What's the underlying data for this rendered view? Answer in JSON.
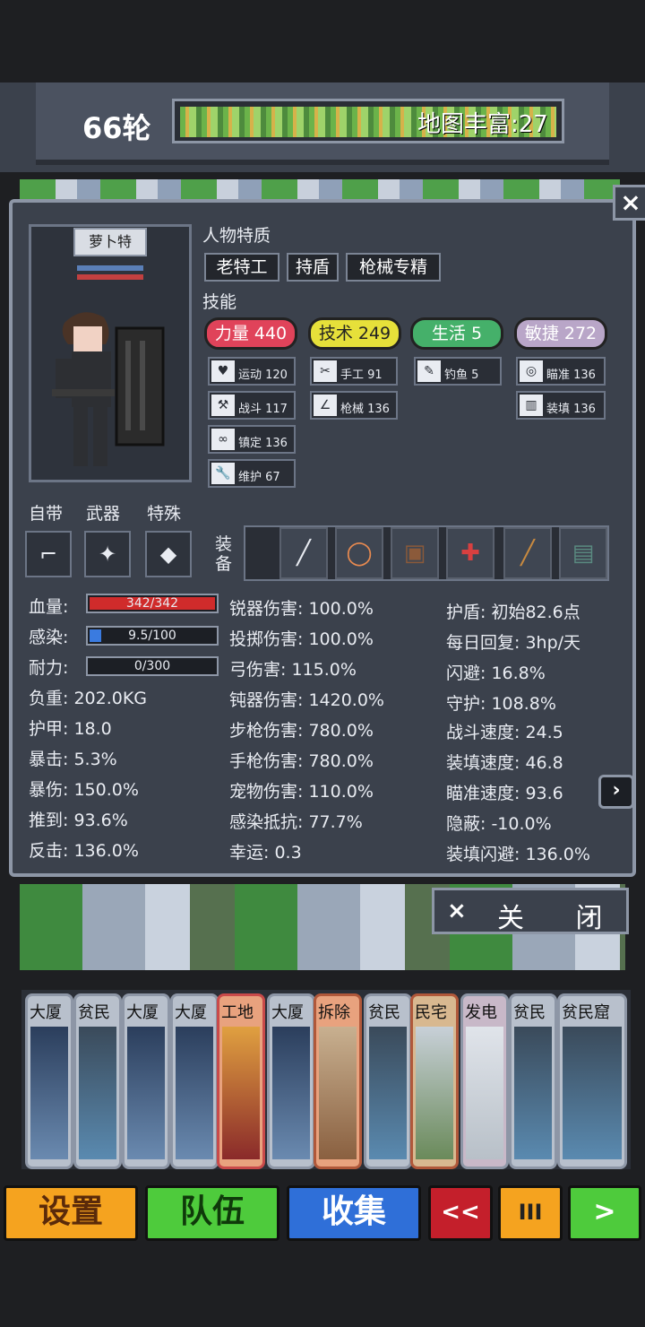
{
  "header": {
    "round": "66轮",
    "map_richness": "地图丰富:27"
  },
  "panel": {
    "close_icon": "×",
    "character_name": "萝卜特",
    "traits_title": "人物特质",
    "traits": [
      "老特工",
      "持盾",
      "枪械专精"
    ],
    "skills_title": "技能",
    "skills": [
      {
        "label": "力量 440",
        "color": "#e0435a"
      },
      {
        "label": "技术 249",
        "color": "#e6e03a"
      },
      {
        "label": "生活 5",
        "color": "#45b06a"
      },
      {
        "label": "敏捷 272",
        "color": "#b9a6c8"
      }
    ],
    "subskills": {
      "s1": {
        "icon": "♥",
        "label": "运动 120"
      },
      "s2": {
        "icon": "⚒",
        "label": "战斗 117"
      },
      "s3": {
        "icon": "∞",
        "label": "镇定 136"
      },
      "s4": {
        "icon": "🔧",
        "label": "维护 67"
      },
      "s5": {
        "icon": "✂",
        "label": "手工 91"
      },
      "s6": {
        "icon": "∠",
        "label": "枪械 136"
      },
      "s7": {
        "icon": "✎",
        "label": "钓鱼 5"
      },
      "s8": {
        "icon": "◎",
        "label": "瞄准 136"
      },
      "s9": {
        "icon": "▥",
        "label": "装填 136"
      }
    },
    "slot_labels": {
      "builtin": "自带",
      "weapon": "武器",
      "special": "特殊"
    },
    "equip_label": "装备",
    "stats_left": {
      "hp_label": "血量:",
      "hp_value": "342/342",
      "hp_fraction": 1.0,
      "infect_label": "感染:",
      "infect_value": "9.5/100",
      "infect_fraction": 0.095,
      "stamina_label": "耐力:",
      "stamina_value": "0/300",
      "stamina_fraction": 0,
      "load": "负重: 202.0KG",
      "armor": "护甲: 18.0",
      "crit": "暴击: 5.3%",
      "crit_dmg": "暴伤: 150.0%",
      "knockdown": "推到: 93.6%",
      "counter": "反击: 136.0%"
    },
    "stats_mid": [
      "锐器伤害: 100.0%",
      "投掷伤害: 100.0%",
      "弓伤害: 115.0%",
      "钝器伤害: 1420.0%",
      "步枪伤害: 780.0%",
      "手枪伤害: 780.0%",
      "宠物伤害: 110.0%",
      "感染抵抗: 77.7%",
      "幸运: 0.3"
    ],
    "stats_right": [
      "护盾: 初始82.6点",
      "每日回复: 3hp/天",
      "闪避: 16.8%",
      "守护: 108.8%",
      "战斗速度: 24.5",
      "装填速度: 46.8",
      "瞄准速度: 93.6",
      "隐蔽: -10.0%",
      "装填闪避: 136.0%"
    ]
  },
  "close_button": {
    "icon": "×",
    "label": "关 闭"
  },
  "cards": [
    "大厦",
    "贫民",
    "大厦",
    "大厦",
    "工地",
    "大厦",
    "拆除",
    "贫民",
    "民宅",
    "发电",
    "贫民",
    "贫民窟"
  ],
  "bottom": {
    "settings": "设置",
    "team": "队伍",
    "collect": "收集",
    "rewind": "<<",
    "pause": "III",
    "next": ">"
  }
}
